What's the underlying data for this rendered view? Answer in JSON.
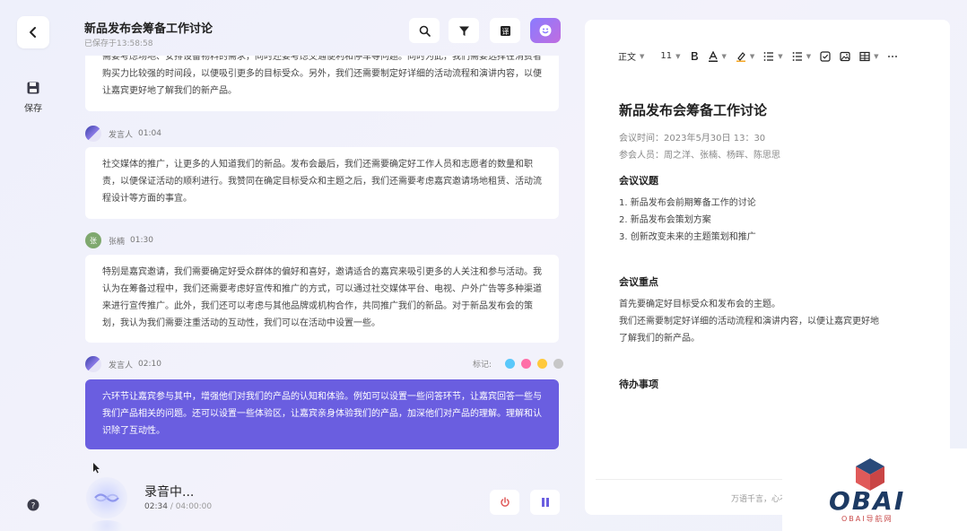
{
  "rail": {
    "save_label": "保存"
  },
  "header": {
    "title": "新品发布会筹备工作讨论",
    "subtitle": "已保存于13:58:58"
  },
  "transcript": {
    "top_fragment": "需要考虑场地、安排设备物料的需求，同时还要考虑交通便利和停车等问题。同时为此，我们需要选择在消费者购买力比较强的时间段，以便吸引更多的目标受众。另外，我们还需要制定好详细的活动流程和演讲内容，以便让嘉宾更好地了解我们的新产品。",
    "entries": [
      {
        "speaker": "发言人",
        "time": "01:04",
        "text": "社交媒体的推广，让更多的人知道我们的新品。发布会最后，我们还需要确定好工作人员和志愿者的数量和职责，以便保证活动的顺利进行。我赞同在确定目标受众和主题之后，我们还需要考虑嘉宾邀请场地租赁、活动流程设计等方面的事宜。"
      },
      {
        "speaker": "张楠",
        "time": "01:30",
        "avatar_text": "张",
        "text": "特别是嘉宾邀请，我们需要确定好受众群体的偏好和喜好，邀请适合的嘉宾来吸引更多的人关注和参与活动。我认为在筹备过程中，我们还需要考虑好宣传和推广的方式，可以通过社交媒体平台、电视、户外广告等多种渠道来进行宣传推广。此外，我们还可以考虑与其他品牌或机构合作，共同推广我们的新品。对于新品发布会的策划，我认为我们需要注重活动的互动性，我们可以在活动中设置一些。"
      },
      {
        "speaker": "发言人",
        "time": "02:10",
        "text": "六环节让嘉宾参与其中，增强他们对我们的产品的认知和体验。例如可以设置一些问答环节，让嘉宾回答一些与我们产品相关的问题。还可以设置一些体验区，让嘉宾亲身体验我们的产品，加深他们对产品的理解。理解和认识除了互动性。"
      }
    ],
    "mark_label": "标记:",
    "mark_colors": [
      "#5ac8fa",
      "#ff6fa8",
      "#ffc93c",
      "#c7c7c7"
    ]
  },
  "recording": {
    "status": "录音中...",
    "elapsed": "02:34",
    "total": "/ 04:00:00"
  },
  "editor": {
    "toolbar": {
      "style": "正文",
      "font_size": "11"
    },
    "doc_title": "新品发布会筹备工作讨论",
    "meeting_time": "会议时间：2023年5月30日 13：30",
    "attendees": "参会人员：周之洋、张楠、杨晖、陈思思",
    "section_topics": "会议议题",
    "topics": [
      "1.  新品发布会前期筹备工作的讨论",
      "2.  新品发布会策划方案",
      "3.  创新改变未来的主题策划和推广"
    ],
    "section_focus": "会议重点",
    "focus_text": [
      "首先要确定好目标受众和发布会的主题。",
      "我们还需要制定好详细的活动流程和演讲内容，以便让嘉宾更好地",
      "了解我们的新产品。"
    ],
    "section_todo": "待办事项",
    "footer": "万语千言，心不"
  },
  "watermark": {
    "brand": "OBAI",
    "sub": "OBAI导航网"
  },
  "colors": {
    "accent": "#6a5ee0",
    "stop": "#e05a5a",
    "pause": "#6a5ee0"
  }
}
